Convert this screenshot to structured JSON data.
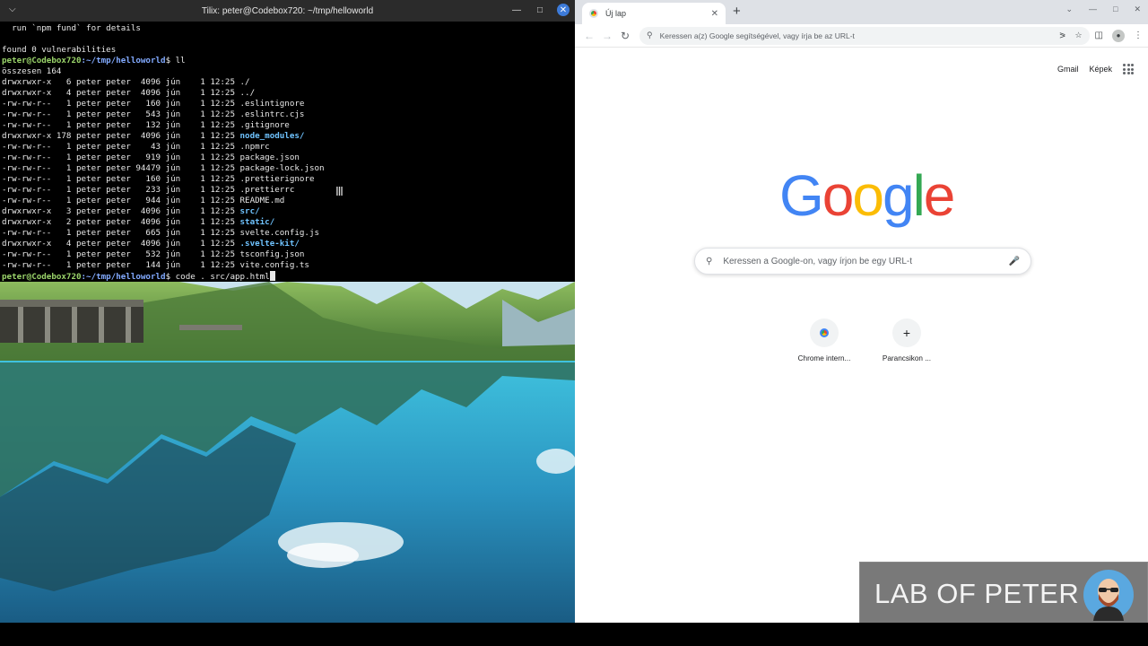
{
  "terminal": {
    "title": "Tilix: peter@Codebox720: ~/tmp/helloworld",
    "lines": [
      {
        "text": "  run `npm fund` for details",
        "kind": "plain"
      },
      {
        "text": "",
        "kind": "plain"
      },
      {
        "text": "found 0 vulnerabilities",
        "kind": "plain"
      },
      {
        "user": "peter@Codebox720",
        "path": ":~/tmp/helloworld",
        "cmd": "$ ll",
        "kind": "prompt"
      },
      {
        "text": "összesen 164",
        "kind": "plain"
      },
      {
        "meta": "drwxrwxr-x   6 peter peter  4096 jún    1 12:25 ",
        "name": "./",
        "kind": "entry"
      },
      {
        "meta": "drwxrwxr-x   4 peter peter  4096 jún    1 12:25 ",
        "name": "../",
        "kind": "entry"
      },
      {
        "meta": "-rw-rw-r--   1 peter peter   160 jún    1 12:25 ",
        "name": ".eslintignore",
        "kind": "entry"
      },
      {
        "meta": "-rw-rw-r--   1 peter peter   543 jún    1 12:25 ",
        "name": ".eslintrc.cjs",
        "kind": "entry"
      },
      {
        "meta": "-rw-rw-r--   1 peter peter   132 jún    1 12:25 ",
        "name": ".gitignore",
        "kind": "entry"
      },
      {
        "meta": "drwxrwxr-x 178 peter peter  4096 jún    1 12:25 ",
        "name": "node_modules/",
        "kind": "dir"
      },
      {
        "meta": "-rw-rw-r--   1 peter peter    43 jún    1 12:25 ",
        "name": ".npmrc",
        "kind": "entry"
      },
      {
        "meta": "-rw-rw-r--   1 peter peter   919 jún    1 12:25 ",
        "name": "package.json",
        "kind": "entry"
      },
      {
        "meta": "-rw-rw-r--   1 peter peter 94479 jún    1 12:25 ",
        "name": "package-lock.json",
        "kind": "entry"
      },
      {
        "meta": "-rw-rw-r--   1 peter peter   160 jún    1 12:25 ",
        "name": ".prettierignore",
        "kind": "entry"
      },
      {
        "meta": "-rw-rw-r--   1 peter peter   233 jún    1 12:25 ",
        "name": ".prettierrc",
        "kind": "entry"
      },
      {
        "meta": "-rw-rw-r--   1 peter peter   944 jún    1 12:25 ",
        "name": "README.md",
        "kind": "entry"
      },
      {
        "meta": "drwxrwxr-x   3 peter peter  4096 jún    1 12:25 ",
        "name": "src/",
        "kind": "dir"
      },
      {
        "meta": "drwxrwxr-x   2 peter peter  4096 jún    1 12:25 ",
        "name": "static/",
        "kind": "dir"
      },
      {
        "meta": "-rw-rw-r--   1 peter peter   665 jún    1 12:25 ",
        "name": "svelte.config.js",
        "kind": "entry"
      },
      {
        "meta": "drwxrwxr-x   4 peter peter  4096 jún    1 12:25 ",
        "name": ".svelte-kit/",
        "kind": "dir"
      },
      {
        "meta": "-rw-rw-r--   1 peter peter   532 jún    1 12:25 ",
        "name": "tsconfig.json",
        "kind": "entry"
      },
      {
        "meta": "-rw-rw-r--   1 peter peter   144 jún    1 12:25 ",
        "name": "vite.config.ts",
        "kind": "entry"
      },
      {
        "user": "peter@Codebox720",
        "path": ":~/tmp/helloworld",
        "cmd": "$ code . src/app.html",
        "kind": "prompt-cursor"
      }
    ]
  },
  "browser": {
    "tab_title": "Új lap",
    "omnibox_placeholder": "Keressen a(z) Google segítségével, vagy írja be az URL-t",
    "top_links": {
      "gmail": "Gmail",
      "images": "Képek"
    },
    "logo": [
      "G",
      "o",
      "o",
      "g",
      "l",
      "e"
    ],
    "logo_colors": [
      "#4285f4",
      "#ea4335",
      "#fbbc05",
      "#4285f4",
      "#34a853",
      "#ea4335"
    ],
    "search_placeholder": "Keressen a Google-on, vagy írjon be egy URL-t",
    "shortcuts": [
      {
        "label": "Chrome intern...",
        "icon": "chrome-icon"
      },
      {
        "label": "Parancsikon ...",
        "icon": "plus-icon"
      }
    ]
  },
  "watermark": {
    "text": "LAB OF PETER"
  }
}
